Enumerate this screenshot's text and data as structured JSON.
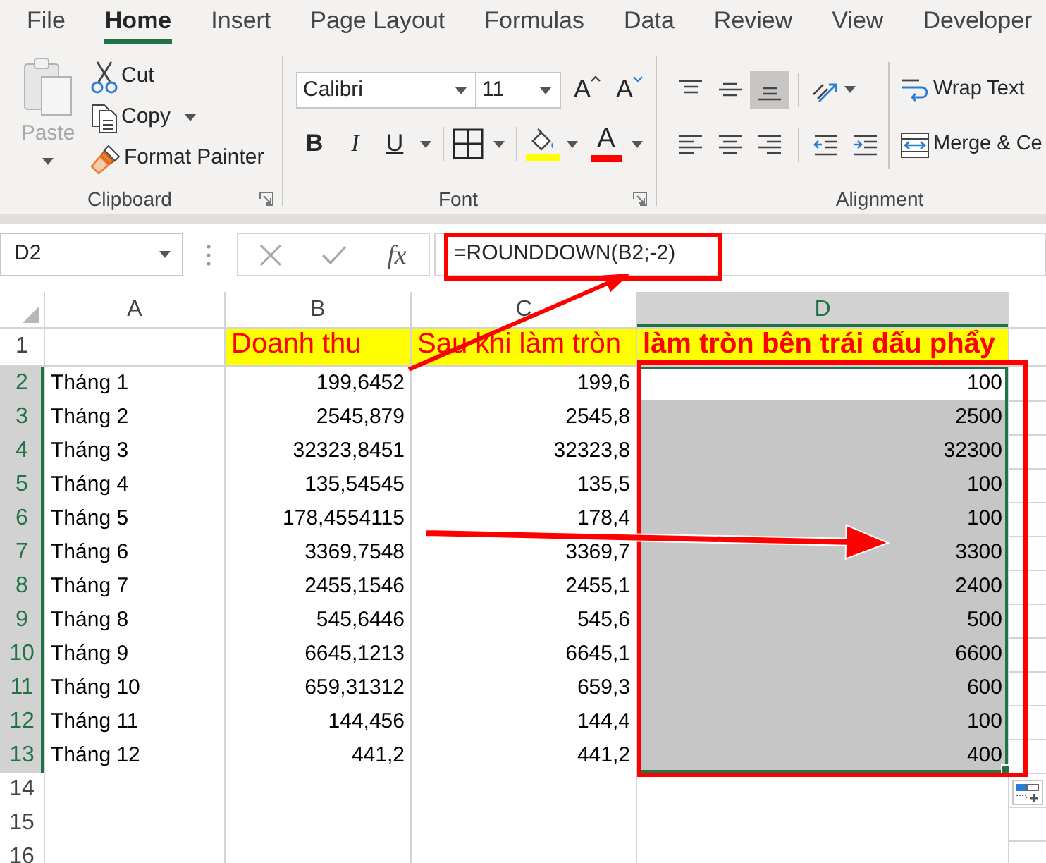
{
  "tabs": [
    {
      "label": "File",
      "selected": false
    },
    {
      "label": "Home",
      "selected": true
    },
    {
      "label": "Insert",
      "selected": false
    },
    {
      "label": "Page Layout",
      "selected": false
    },
    {
      "label": "Formulas",
      "selected": false
    },
    {
      "label": "Data",
      "selected": false
    },
    {
      "label": "Review",
      "selected": false
    },
    {
      "label": "View",
      "selected": false
    },
    {
      "label": "Developer",
      "selected": false
    }
  ],
  "clipboard": {
    "label": "Clipboard",
    "paste": {
      "label": "Paste",
      "disabled": true
    },
    "tools": [
      {
        "kind": "cut",
        "label": "Cut",
        "dropdown": false
      },
      {
        "kind": "copy",
        "label": "Copy",
        "dropdown": true
      },
      {
        "kind": "painter",
        "label": "Format Painter",
        "dropdown": false
      }
    ]
  },
  "font": {
    "label": "Font",
    "font_name": "Calibri",
    "font_size": "11",
    "grow": "A",
    "shrink": "A",
    "bold": "B",
    "italic": "I",
    "underline": "U",
    "font_color": "A"
  },
  "alignment": {
    "label": "Alignment",
    "vertical": [
      {
        "kind": "top",
        "selected": false
      },
      {
        "kind": "middle",
        "selected": false
      },
      {
        "kind": "bottom",
        "selected": true
      }
    ],
    "horizontal": [
      {
        "kind": "left",
        "selected": false
      },
      {
        "kind": "center",
        "selected": false
      },
      {
        "kind": "right",
        "selected": false
      }
    ],
    "wrap_text": "Wrap Text",
    "merge": "Merge & Ce"
  },
  "formula_bar": {
    "name_box": "D2",
    "insert_function": "fx",
    "formula": "=ROUNDDOWN(B2;-2)"
  },
  "sheet": {
    "columns": [
      {
        "label": "A",
        "selected": false
      },
      {
        "label": "B",
        "selected": false
      },
      {
        "label": "C",
        "selected": false
      },
      {
        "label": "D",
        "selected": true
      }
    ],
    "rows": [
      {
        "number": "1",
        "selected": false,
        "cells": {
          "b": {
            "kind": "heading",
            "text": "Doanh thu",
            "bold": false,
            "selected": false
          },
          "c": {
            "kind": "heading",
            "text": "Sau khi làm tròn",
            "bold": false,
            "selected": false
          },
          "d": {
            "kind": "heading",
            "text": "làm tròn bên trái dấu phẩy",
            "bold": true,
            "selected": false
          }
        }
      },
      {
        "number": "2",
        "selected": true,
        "cells": {
          "a": {
            "kind": "text",
            "text": "Tháng 1",
            "selected": false
          },
          "b": {
            "kind": "number",
            "text": "199,6452",
            "selected": false
          },
          "c": {
            "kind": "number",
            "text": "199,6",
            "selected": false
          },
          "d": {
            "kind": "number",
            "text": "100",
            "selected": true
          }
        }
      },
      {
        "number": "3",
        "selected": true,
        "cells": {
          "a": {
            "kind": "text",
            "text": "Tháng 2",
            "selected": false
          },
          "b": {
            "kind": "number",
            "text": "2545,879",
            "selected": false
          },
          "c": {
            "kind": "number",
            "text": "2545,8",
            "selected": false
          },
          "d": {
            "kind": "number",
            "text": "2500",
            "selected": true
          }
        }
      },
      {
        "number": "4",
        "selected": true,
        "cells": {
          "a": {
            "kind": "text",
            "text": "Tháng 3",
            "selected": false
          },
          "b": {
            "kind": "number",
            "text": "32323,8451",
            "selected": false
          },
          "c": {
            "kind": "number",
            "text": "32323,8",
            "selected": false
          },
          "d": {
            "kind": "number",
            "text": "32300",
            "selected": true
          }
        }
      },
      {
        "number": "5",
        "selected": true,
        "cells": {
          "a": {
            "kind": "text",
            "text": "Tháng 4",
            "selected": false
          },
          "b": {
            "kind": "number",
            "text": "135,54545",
            "selected": false
          },
          "c": {
            "kind": "number",
            "text": "135,5",
            "selected": false
          },
          "d": {
            "kind": "number",
            "text": "100",
            "selected": true
          }
        }
      },
      {
        "number": "6",
        "selected": true,
        "cells": {
          "a": {
            "kind": "text",
            "text": "Tháng 5",
            "selected": false
          },
          "b": {
            "kind": "number",
            "text": "178,4554115",
            "selected": false
          },
          "c": {
            "kind": "number",
            "text": "178,4",
            "selected": false
          },
          "d": {
            "kind": "number",
            "text": "100",
            "selected": true
          }
        }
      },
      {
        "number": "7",
        "selected": true,
        "cells": {
          "a": {
            "kind": "text",
            "text": "Tháng 6",
            "selected": false
          },
          "b": {
            "kind": "number",
            "text": "3369,7548",
            "selected": false
          },
          "c": {
            "kind": "number",
            "text": "3369,7",
            "selected": false
          },
          "d": {
            "kind": "number",
            "text": "3300",
            "selected": true
          }
        }
      },
      {
        "number": "8",
        "selected": true,
        "cells": {
          "a": {
            "kind": "text",
            "text": "Tháng 7",
            "selected": false
          },
          "b": {
            "kind": "number",
            "text": "2455,1546",
            "selected": false
          },
          "c": {
            "kind": "number",
            "text": "2455,1",
            "selected": false
          },
          "d": {
            "kind": "number",
            "text": "2400",
            "selected": true
          }
        }
      },
      {
        "number": "9",
        "selected": true,
        "cells": {
          "a": {
            "kind": "text",
            "text": "Tháng 8",
            "selected": false
          },
          "b": {
            "kind": "number",
            "text": "545,6446",
            "selected": false
          },
          "c": {
            "kind": "number",
            "text": "545,6",
            "selected": false
          },
          "d": {
            "kind": "number",
            "text": "500",
            "selected": true
          }
        }
      },
      {
        "number": "10",
        "selected": true,
        "cells": {
          "a": {
            "kind": "text",
            "text": "Tháng 9",
            "selected": false
          },
          "b": {
            "kind": "number",
            "text": "6645,1213",
            "selected": false
          },
          "c": {
            "kind": "number",
            "text": "6645,1",
            "selected": false
          },
          "d": {
            "kind": "number",
            "text": "6600",
            "selected": true
          }
        }
      },
      {
        "number": "11",
        "selected": true,
        "cells": {
          "a": {
            "kind": "text",
            "text": "Tháng 10",
            "selected": false
          },
          "b": {
            "kind": "number",
            "text": "659,31312",
            "selected": false
          },
          "c": {
            "kind": "number",
            "text": "659,3",
            "selected": false
          },
          "d": {
            "kind": "number",
            "text": "600",
            "selected": true
          }
        }
      },
      {
        "number": "12",
        "selected": true,
        "cells": {
          "a": {
            "kind": "text",
            "text": "Tháng 11",
            "selected": false
          },
          "b": {
            "kind": "number",
            "text": "144,456",
            "selected": false
          },
          "c": {
            "kind": "number",
            "text": "144,4",
            "selected": false
          },
          "d": {
            "kind": "number",
            "text": "100",
            "selected": true
          }
        }
      },
      {
        "number": "13",
        "selected": true,
        "cells": {
          "a": {
            "kind": "text",
            "text": "Tháng 12",
            "selected": false
          },
          "b": {
            "kind": "number",
            "text": "441,2",
            "selected": false
          },
          "c": {
            "kind": "number",
            "text": "441,2",
            "selected": false
          },
          "d": {
            "kind": "number",
            "text": "400",
            "selected": true
          }
        }
      },
      {
        "number": "14",
        "selected": false
      },
      {
        "number": "15",
        "selected": false
      },
      {
        "number": "16",
        "selected": false
      }
    ]
  },
  "annotations": [
    {
      "kind": "formula-box"
    },
    {
      "kind": "selection-box"
    },
    {
      "kind": "formula-arrow"
    },
    {
      "kind": "selection-arrow"
    }
  ]
}
